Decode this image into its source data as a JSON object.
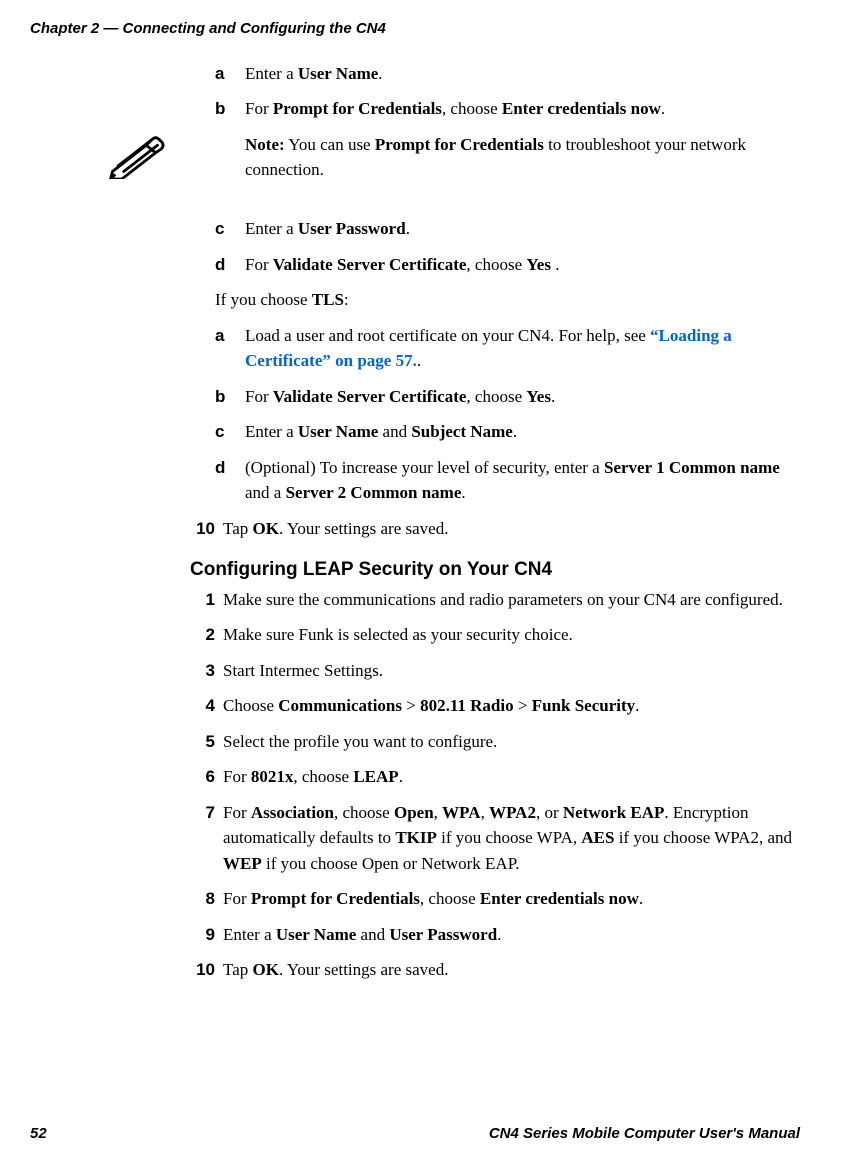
{
  "header": "Chapter 2 — Connecting and Configuring the CN4",
  "top_sub": [
    {
      "m": "a",
      "html": "Enter a <b>User Name</b>."
    },
    {
      "m": "b",
      "html": "For <b>Prompt for Credentials</b>, choose <b>Enter credentials now</b>."
    }
  ],
  "note": "<b>Note:</b> You can use <b>Prompt for Credentials</b> to troubleshoot your network connection.",
  "mid_sub": [
    {
      "m": "c",
      "html": "Enter a <b>User Password</b>."
    },
    {
      "m": "d",
      "html": "For <b>Validate Server Certificate</b>, choose <b>Yes</b> ."
    }
  ],
  "tls_line": "If you choose <b>TLS</b>:",
  "tls_sub": [
    {
      "m": "a",
      "html": "Load a user and root certificate on your CN4. For help, see <span class=\"link\">“Loading a Certificate” on page 57.</span>."
    },
    {
      "m": "b",
      "html": "For <b>Validate Server Certificate</b>, choose <b>Yes</b>."
    },
    {
      "m": "c",
      "html": "Enter a <b>User Name</b> and <b>Subject Name</b>."
    },
    {
      "m": "d",
      "html": "(Optional) To increase your level of security, enter a <b>Server 1 Common name</b> and a <b>Server 2 Common name</b>."
    }
  ],
  "step10": {
    "m": "10",
    "html": "Tap <b>OK</b>. Your settings are saved."
  },
  "leap_heading": "Configuring LEAP Security on Your CN4",
  "leap_steps": [
    {
      "m": "1",
      "html": "Make sure the communications and radio parameters on your CN4 are configured."
    },
    {
      "m": "2",
      "html": "Make sure Funk is selected as your security choice."
    },
    {
      "m": "3",
      "html": "Start Intermec Settings."
    },
    {
      "m": "4",
      "html": "Choose <b>Communications</b> > <b>802.11 Radio</b> > <b>Funk Security</b>."
    },
    {
      "m": "5",
      "html": "Select the profile you want to configure."
    },
    {
      "m": "6",
      "html": "For <b>8021x</b>, choose <b>LEAP</b>."
    },
    {
      "m": "7",
      "html": "For <b>Association</b>, choose <b>Open</b>, <b>WPA</b>, <b>WPA2</b>, or <b>Network EAP</b>. Encryption automatically defaults to <b>TKIP</b> if you choose WPA, <b>AES</b> if you choose WPA2, and <b>WEP</b> if you choose Open or Network EAP."
    },
    {
      "m": "8",
      "html": "For <b>Prompt for Credentials</b>, choose <b>Enter credentials now</b>."
    },
    {
      "m": "9",
      "html": "Enter a <b>User Name</b> and <b>User Password</b>."
    },
    {
      "m": "10",
      "html": "Tap <b>OK</b>. Your settings are saved."
    }
  ],
  "footer": {
    "page": "52",
    "title": "CN4 Series Mobile Computer User's Manual"
  }
}
